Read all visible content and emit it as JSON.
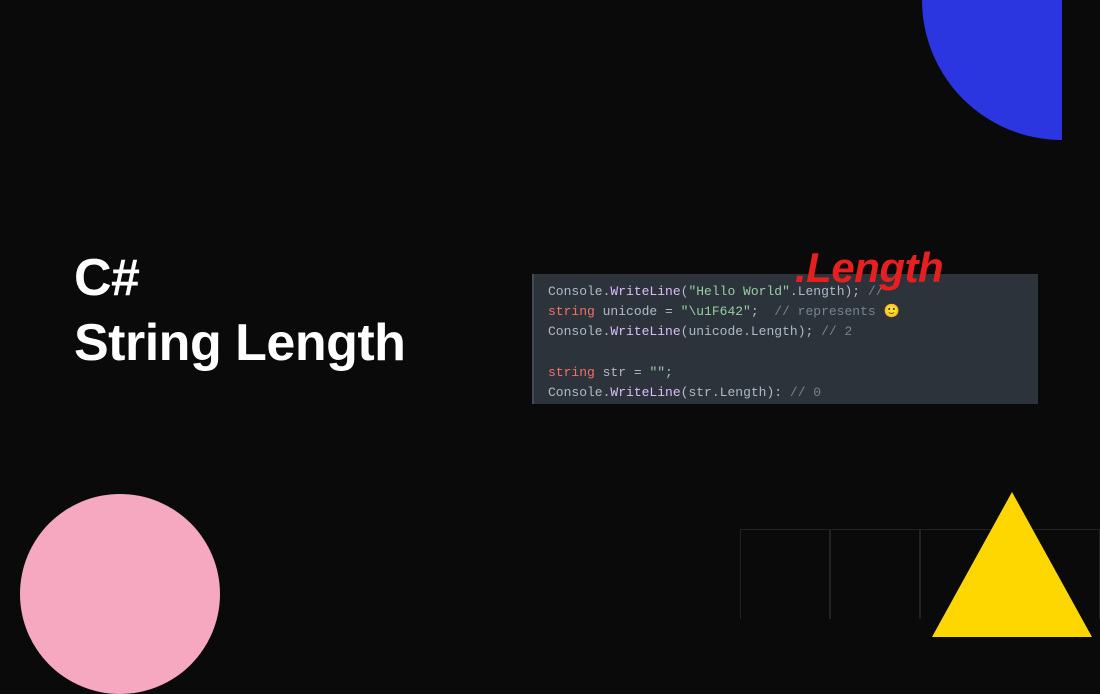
{
  "title": {
    "line1": "C#",
    "line2": "String Length"
  },
  "lengthLabel": ".Length",
  "code": {
    "line1": {
      "method1": "Console",
      "dot1": ".",
      "method2": "WriteLine",
      "paren1": "(",
      "str": "\"Hello World\"",
      "dot2": ".",
      "prop": "Length",
      "close": ");",
      "comment": " // ",
      "trail": ""
    },
    "line2": {
      "kw": "string",
      "sp": " ",
      "var": "unicode",
      "eq": " = ",
      "str": "\"\\u1F642\"",
      "semi": ";  ",
      "comment": "// represents ",
      "emoji": "🙂"
    },
    "line3": {
      "method1": "Console",
      "dot1": ".",
      "method2": "WriteLine",
      "paren1": "(",
      "var": "unicode",
      "dot2": ".",
      "prop": "Length",
      "close": ");",
      "comment": " // 2"
    },
    "line5": {
      "kw": "string",
      "sp": " ",
      "var": "str",
      "eq": " = ",
      "str": "\"\"",
      "semi": ";"
    },
    "line6": {
      "method1": "Console",
      "dot1": ".",
      "method2": "WriteLine",
      "paren1": "(",
      "var": "str",
      "dot2": ".",
      "prop": "Length",
      "close": "):",
      "comment": " // 0"
    }
  },
  "colors": {
    "background": "#0a0a0a",
    "blue": "#2b35e0",
    "pink": "#f5a8c0",
    "yellow": "#ffd700",
    "red": "#e81f1f",
    "codeBg": "#2d333b"
  }
}
